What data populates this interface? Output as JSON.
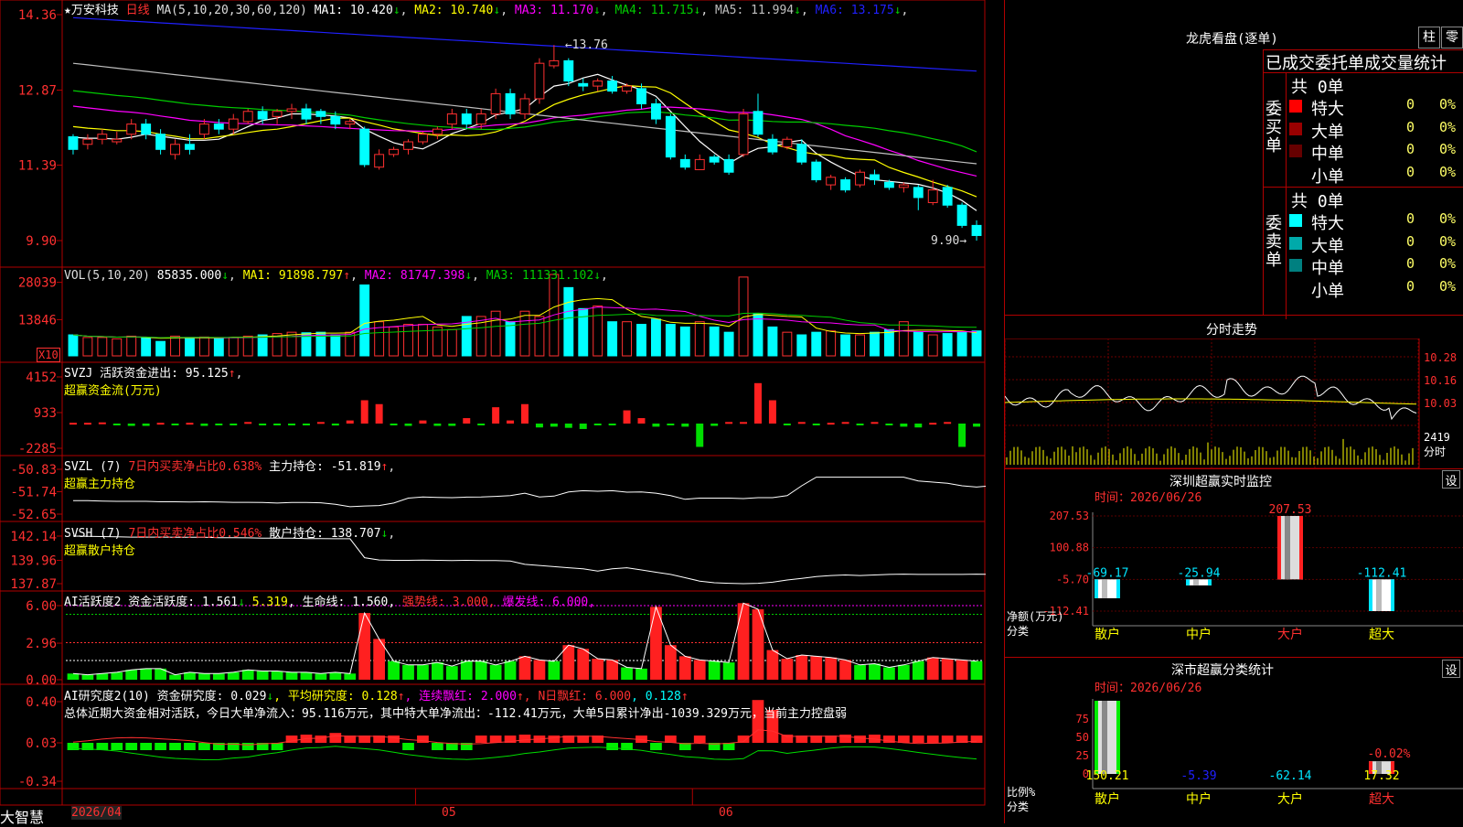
{
  "stock": {
    "name": "万安科技",
    "period": "日线"
  },
  "bottom_label": "大智慧",
  "main_panel": {
    "ma_header": "MA(5,10,20,30,60,120)",
    "ma": [
      {
        "label": "MA1:",
        "value": "10.420",
        "arrow": "↓",
        "color": "#ffffff"
      },
      {
        "label": "MA2:",
        "value": "10.740",
        "arrow": "↓",
        "color": "#ffff00"
      },
      {
        "label": "MA3:",
        "value": "11.170",
        "arrow": "↓",
        "color": "#ff00ff"
      },
      {
        "label": "MA4:",
        "value": "11.715",
        "arrow": "↓",
        "color": "#00cc00"
      },
      {
        "label": "MA5:",
        "value": "11.994",
        "arrow": "↓",
        "color": "#c0c0c0"
      },
      {
        "label": "MA6:",
        "value": "13.175",
        "arrow": "↓",
        "color": "#2020ff"
      }
    ],
    "y_ticks": [
      "14.36",
      "12.87",
      "11.39",
      "9.90"
    ],
    "high_label": "13.76",
    "low_label": "9.90"
  },
  "vol_panel": {
    "header": "VOL(5,10,20)",
    "value": "85835.000",
    "ma": [
      {
        "label": "MA1:",
        "value": "91898.797",
        "arrow": "↑",
        "color": "#ffff00"
      },
      {
        "label": "MA2:",
        "value": "81747.398",
        "arrow": "↓",
        "color": "#ff00ff"
      },
      {
        "label": "MA3:",
        "value": "111331.102",
        "arrow": "↓",
        "color": "#00cc00"
      }
    ],
    "y_ticks": [
      "28039",
      "13846"
    ],
    "unit": "X10"
  },
  "svzj_panel": {
    "line1": "SVZJ  活跃资金进出: 95.125",
    "arrow": "↑",
    "line2": "超赢资金流(万元)",
    "y_ticks": [
      "4152",
      "933",
      "-2285"
    ]
  },
  "svzl_panel": {
    "prefix": "SVZL  (7) ",
    "red_text": "7日内买卖净占比0.638%",
    "rest": " 主力持仓: -51.819",
    "arrow": "↑",
    "line2": "超赢主力持仓",
    "y_ticks": [
      "-50.83",
      "-51.74",
      "-52.65"
    ]
  },
  "svsh_panel": {
    "prefix": "SVSH  (7) ",
    "red_text": "7日内买卖净占比0.546%",
    "rest": " 散户持仓: 138.707",
    "arrow": "↓",
    "line2": "超赢散户持仓",
    "y_ticks": [
      "142.14",
      "139.96",
      "137.87"
    ]
  },
  "ai_panel": {
    "prefix": "AI活跃度2 资金活跃度: 1.561",
    "a1": "↓",
    "mid": " 5.319",
    "a2": ", 生命线: 1.560,",
    "strong": " 强势线: 3.000,",
    "burst": " 爆发线: 6.000,",
    "y_ticks": [
      "6.00",
      "2.96",
      "0.00"
    ]
  },
  "ai2_panel": {
    "prefix": "AI研究度2(10) 资金研究度: 0.029",
    "a1": "↓",
    "avg": ", 平均研究度: 0.128",
    "a2": "↑",
    "cont": ", 连续飘红: 2.000",
    "a3": "↑",
    "nday": ", N日飘红: 6.000",
    "last": ", 0.128",
    "a4": "↑",
    "summary": "总体近期大资金相对活跃，今日大单净流入：95.116万元，其中特大单净流出：-112.41万元，大单5日累计净出-1039.329万元，当前主力控盘弱",
    "y_ticks": [
      "0.40",
      "0.03",
      "-0.34"
    ]
  },
  "x_axis": {
    "labels": [
      "2026/04",
      "05",
      "06"
    ]
  },
  "right": {
    "dragon_title": "龙虎看盘(逐单)",
    "btn1": "柱",
    "btn2": "零",
    "stats_title": "已成交委托单成交量统计",
    "buy_label": "委买单",
    "sell_label": "委卖单",
    "buy_total": "共 0单",
    "sell_total": "共 0单",
    "buy_rows": [
      {
        "name": "特大",
        "qty": "0",
        "pct": "0%",
        "color": "#ff0000"
      },
      {
        "name": "大单",
        "qty": "0",
        "pct": "0%",
        "color": "#990000"
      },
      {
        "name": "中单",
        "qty": "0",
        "pct": "0%",
        "color": "#660000"
      },
      {
        "name": "小单",
        "qty": "0",
        "pct": "0%",
        "color": "#000000"
      }
    ],
    "sell_rows": [
      {
        "name": "特大",
        "qty": "0",
        "pct": "0%",
        "color": "#00ffff"
      },
      {
        "name": "大单",
        "qty": "0",
        "pct": "0%",
        "color": "#00aaaa"
      },
      {
        "name": "中单",
        "qty": "0",
        "pct": "0%",
        "color": "#008080"
      },
      {
        "name": "小单",
        "qty": "0",
        "pct": "0%",
        "color": "#000000"
      }
    ],
    "intraday_title": "分时走势",
    "intraday_ticks": [
      "10.28",
      "10.16",
      "10.03"
    ],
    "intraday_vol": "2419",
    "intraday_unit": "分时",
    "monitor_title": "深圳超赢实时监控",
    "monitor_btn": "设",
    "monitor_time": "时间：2026/06/26",
    "monitor_ticks": [
      "207.53",
      "100.88",
      "-5.70",
      "-112.41"
    ],
    "monitor_ylabel": "净额(万元)",
    "monitor_xlabel": "分类",
    "class_title": "深市超赢分类统计",
    "class_btn": "设",
    "class_time": "时间：2026/06/26",
    "class_ticks": [
      "75",
      "50",
      "25",
      "0"
    ],
    "class_ylabel": "比例%",
    "class_xlabel": "分类"
  },
  "chart_data": [
    {
      "type": "bar",
      "title": "深圳超赢实时监控",
      "categories": [
        "散户",
        "中户",
        "大户",
        "超大"
      ],
      "values": [
        -69.17,
        -25.94,
        207.53,
        -112.41
      ],
      "ylabel": "净额(万元)",
      "xlabel": "分类",
      "ylim": [
        -112.41,
        207.53
      ]
    },
    {
      "type": "bar",
      "title": "深市超赢分类统计",
      "categories": [
        "散户",
        "中户",
        "大户",
        "超大"
      ],
      "values": [
        150.21,
        -5.39,
        -62.14,
        17.32
      ],
      "top_labels": [
        "",
        "",
        "",
        "-0.02%"
      ],
      "ylabel": "比例%",
      "xlabel": "分类",
      "y_ticks": [
        75,
        50,
        25,
        0
      ]
    },
    {
      "type": "line",
      "title": "万安科技 日线",
      "x_labels": [
        "2026/04",
        "05",
        "06"
      ],
      "y_ticks": [
        14.36,
        12.87,
        11.39,
        9.9
      ],
      "high": 13.76,
      "low": 9.9,
      "ohlc": [
        [
          11.95,
          11.7,
          12.0,
          11.6
        ],
        [
          11.8,
          11.9,
          12.0,
          11.7
        ],
        [
          11.9,
          12.0,
          12.1,
          11.8
        ],
        [
          11.85,
          11.9,
          12.05,
          11.8
        ],
        [
          12.0,
          12.2,
          12.3,
          11.9
        ],
        [
          12.2,
          12.0,
          12.3,
          11.9
        ],
        [
          12.0,
          11.7,
          12.1,
          11.6
        ],
        [
          11.6,
          11.8,
          11.9,
          11.5
        ],
        [
          11.8,
          11.7,
          12.0,
          11.6
        ],
        [
          12.0,
          12.2,
          12.3,
          11.9
        ],
        [
          12.2,
          12.1,
          12.3,
          12.0
        ],
        [
          12.1,
          12.3,
          12.4,
          12.0
        ],
        [
          12.25,
          12.45,
          12.5,
          12.2
        ],
        [
          12.45,
          12.3,
          12.55,
          12.2
        ],
        [
          12.35,
          12.45,
          12.5,
          12.2
        ],
        [
          12.45,
          12.5,
          12.6,
          12.3
        ],
        [
          12.5,
          12.3,
          12.6,
          12.2
        ],
        [
          12.45,
          12.35,
          12.5,
          12.2
        ],
        [
          12.35,
          12.2,
          12.45,
          12.1
        ],
        [
          12.2,
          12.25,
          12.3,
          12.1
        ],
        [
          12.1,
          11.4,
          12.15,
          11.35
        ],
        [
          11.35,
          11.6,
          11.7,
          11.3
        ],
        [
          11.6,
          11.7,
          11.75,
          11.55
        ],
        [
          11.7,
          11.85,
          11.9,
          11.6
        ],
        [
          11.85,
          12.0,
          12.05,
          11.8
        ],
        [
          12.0,
          12.1,
          12.15,
          11.9
        ],
        [
          12.2,
          12.4,
          12.5,
          12.1
        ],
        [
          12.4,
          12.2,
          12.5,
          12.1
        ],
        [
          12.2,
          12.4,
          12.5,
          12.1
        ],
        [
          12.4,
          12.8,
          12.9,
          12.3
        ],
        [
          12.8,
          12.4,
          12.9,
          12.3
        ],
        [
          12.4,
          12.7,
          12.8,
          12.3
        ],
        [
          12.7,
          13.4,
          13.5,
          12.6
        ],
        [
          13.35,
          13.45,
          13.76,
          13.3
        ],
        [
          13.45,
          13.05,
          13.5,
          12.95
        ],
        [
          13.0,
          12.95,
          13.1,
          12.85
        ],
        [
          12.95,
          13.05,
          13.1,
          12.85
        ],
        [
          13.05,
          12.85,
          13.15,
          12.8
        ],
        [
          12.85,
          12.95,
          13.0,
          12.8
        ],
        [
          12.9,
          12.6,
          13.0,
          12.5
        ],
        [
          12.6,
          12.3,
          12.7,
          12.2
        ],
        [
          12.35,
          11.55,
          12.4,
          11.5
        ],
        [
          11.5,
          11.35,
          11.6,
          11.3
        ],
        [
          11.3,
          11.5,
          11.6,
          11.3
        ],
        [
          11.55,
          11.45,
          11.6,
          11.4
        ],
        [
          11.5,
          11.25,
          11.6,
          11.2
        ],
        [
          11.6,
          12.4,
          12.5,
          11.55
        ],
        [
          12.45,
          12.0,
          12.8,
          11.95
        ],
        [
          11.9,
          11.65,
          12.0,
          11.6
        ],
        [
          11.75,
          11.9,
          11.95,
          11.7
        ],
        [
          11.8,
          11.45,
          11.9,
          11.4
        ],
        [
          11.45,
          11.1,
          11.5,
          11.05
        ],
        [
          11.0,
          11.15,
          11.2,
          10.9
        ],
        [
          11.1,
          10.9,
          11.15,
          10.85
        ],
        [
          11.0,
          11.25,
          11.3,
          10.95
        ],
        [
          11.2,
          11.1,
          11.3,
          11.0
        ],
        [
          11.05,
          10.95,
          11.1,
          10.9
        ],
        [
          10.95,
          11.0,
          11.05,
          10.85
        ],
        [
          10.95,
          10.75,
          11.0,
          10.5
        ],
        [
          10.65,
          10.9,
          11.1,
          10.6
        ],
        [
          10.95,
          10.6,
          11.0,
          10.55
        ],
        [
          10.6,
          10.2,
          10.65,
          10.15
        ],
        [
          10.2,
          10.0,
          10.3,
          9.9
        ]
      ],
      "volume": [
        80,
        70,
        70,
        65,
        75,
        70,
        55,
        75,
        70,
        72,
        68,
        70,
        75,
        80,
        85,
        90,
        88,
        90,
        80,
        90,
        270,
        130,
        110,
        120,
        120,
        110,
        100,
        150,
        150,
        170,
        130,
        170,
        150,
        310,
        260,
        180,
        190,
        130,
        130,
        120,
        140,
        120,
        110,
        130,
        110,
        90,
        300,
        160,
        110,
        90,
        80,
        90,
        95,
        80,
        80,
        90,
        100,
        130,
        90,
        80,
        85,
        90,
        95
      ],
      "svzj": [
        10,
        10,
        15,
        -15,
        -30,
        -30,
        10,
        -20,
        10,
        -30,
        -15,
        -20,
        20,
        -20,
        -20,
        -20,
        -10,
        20,
        -25,
        40,
        300,
        250,
        -15,
        -30,
        40,
        -30,
        -30,
        70,
        -20,
        210,
        40,
        250,
        -50,
        -40,
        -55,
        -70,
        -20,
        -20,
        170,
        70,
        -40,
        -20,
        -40,
        -300,
        -30,
        20,
        20,
        520,
        300,
        -20,
        20,
        -20,
        10,
        20,
        -20,
        20,
        -20,
        -40,
        -50,
        10,
        20,
        -300,
        -40
      ],
      "svzl": [
        -52.1,
        -52.1,
        -52.12,
        -52.13,
        -52.13,
        -52.13,
        -52.15,
        -52.15,
        -52.16,
        -52.15,
        -52.16,
        -52.17,
        -52.17,
        -52.18,
        -52.2,
        -52.18,
        -52.18,
        -52.19,
        -52.25,
        -52.35,
        -52.32,
        -52.3,
        -52.2,
        -52.0,
        -51.95,
        -51.97,
        -51.98,
        -51.96,
        -51.95,
        -51.93,
        -51.9,
        -51.8,
        -51.95,
        -51.92,
        -51.75,
        -51.7,
        -51.72,
        -51.7,
        -51.76,
        -51.75,
        -51.8,
        -51.9,
        -52.05,
        -52.0,
        -52.0,
        -52.0,
        -52.02,
        -51.98,
        -51.98,
        -51.9,
        -51.5,
        -51.15,
        -51.15,
        -51.15,
        -51.15,
        -51.15,
        -51.15,
        -51.15,
        -51.3,
        -51.35,
        -51.4,
        -51.5,
        -51.55,
        -51.5
      ],
      "svsh": [
        142.14,
        142.12,
        142.1,
        142.08,
        142.05,
        142.05,
        142.05,
        142.04,
        142.04,
        142.03,
        142.0,
        142.0,
        141.98,
        141.95,
        141.95,
        141.95,
        141.92,
        141.92,
        141.9,
        141.9,
        140.2,
        140.0,
        139.96,
        139.96,
        139.98,
        139.96,
        139.95,
        139.96,
        139.95,
        139.94,
        139.9,
        139.6,
        139.5,
        139.4,
        139.3,
        139.2,
        139.0,
        139.2,
        139.3,
        139.1,
        138.9,
        138.7,
        138.4,
        138.1,
        137.95,
        137.9,
        137.87,
        137.9,
        138.0,
        138.2,
        138.35,
        138.5,
        138.6,
        138.65,
        138.6,
        138.65,
        138.7,
        138.72,
        138.7,
        138.7,
        138.7,
        138.7,
        138.72,
        138.71
      ],
      "ai_activity": [
        0.5,
        0.4,
        0.5,
        0.6,
        0.8,
        0.9,
        0.9,
        0.4,
        0.6,
        0.5,
        0.5,
        0.6,
        0.8,
        0.7,
        0.7,
        0.6,
        0.6,
        0.5,
        0.6,
        0.5,
        5.4,
        3.3,
        1.5,
        1.2,
        1.2,
        1.4,
        1.1,
        1.5,
        1.5,
        1.2,
        1.5,
        1.9,
        1.6,
        1.5,
        2.8,
        2.5,
        1.7,
        1.6,
        1.0,
        0.9,
        5.9,
        2.8,
        1.9,
        1.6,
        1.5,
        1.4,
        6.2,
        5.7,
        2.4,
        1.7,
        2.0,
        1.9,
        1.8,
        1.6,
        1.2,
        1.3,
        1.0,
        1.2,
        1.5,
        1.8,
        1.7,
        1.6,
        1.5
      ],
      "ai_study": [
        -0.02,
        -0.02,
        -0.01,
        0.0,
        0.0,
        0.0,
        0.0,
        0.01,
        0.02,
        0.01,
        0.0,
        0.02,
        0.0,
        0.02,
        0.01,
        0.03,
        0.05,
        0.03,
        0.06,
        0.03,
        0.03,
        0.04,
        0.03,
        0.02,
        0.03,
        0.02,
        0.02,
        0.02,
        0.03,
        0.04,
        0.04,
        0.05,
        0.03,
        0.03,
        0.04,
        0.03,
        0.03,
        0.02,
        0.02,
        0.03,
        0.02,
        0.03,
        0.02,
        0.04,
        0.02,
        0.02,
        0.03,
        0.26,
        0.2,
        0.05,
        0.04,
        0.03,
        0.04,
        0.05,
        0.04,
        0.05,
        0.04,
        0.03,
        0.03,
        0.04,
        0.04,
        0.04,
        0.03
      ]
    }
  ]
}
